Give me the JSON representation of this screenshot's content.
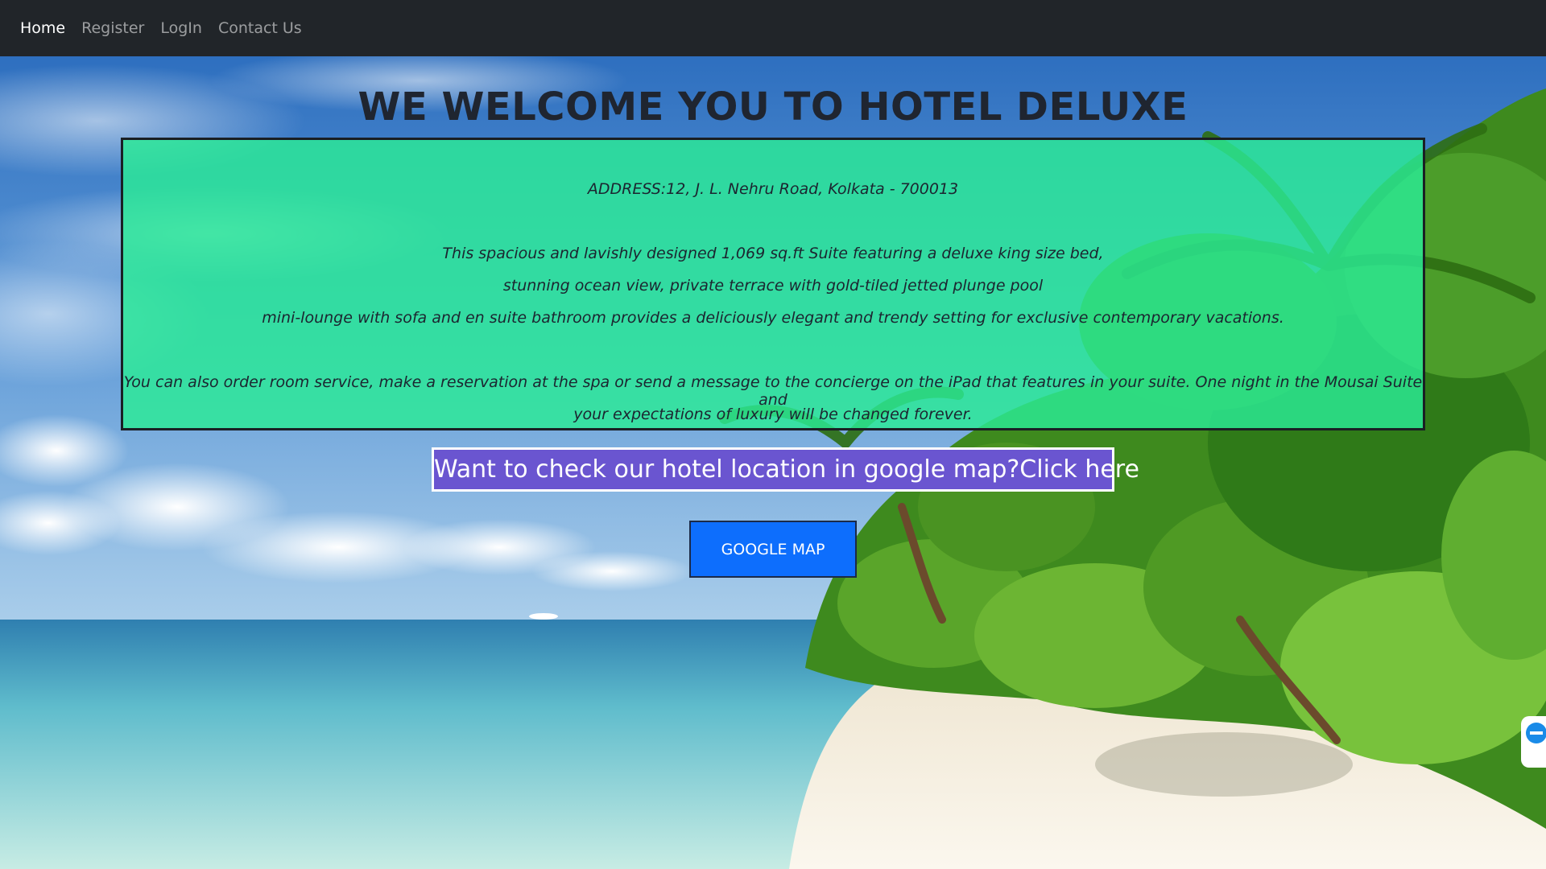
{
  "nav": {
    "items": [
      {
        "label": "Home",
        "active": true
      },
      {
        "label": "Register",
        "active": false
      },
      {
        "label": "LogIn",
        "active": false
      },
      {
        "label": "Contact Us",
        "active": false
      }
    ]
  },
  "hero": {
    "title": "WE WELCOME YOU TO HOTEL DELUXE",
    "address": "ADDRESS:12, J. L. Nehru Road, Kolkata - 700013",
    "description": [
      "This spacious and lavishly designed 1,069 sq.ft Suite featuring a deluxe king size bed,",
      "stunning ocean view, private terrace with gold-tiled jetted plunge pool",
      "mini-lounge with sofa and en suite bathroom provides a deliciously elegant and trendy setting for exclusive contemporary vacations."
    ],
    "room_service": [
      "You can also order room service, make a reservation at the spa or send a message to the concierge on the iPad that features in your suite. One night in the Mousai Suite and",
      "your expectations of luxury will be changed forever."
    ],
    "map_prompt": "Want to check our hotel location in google map?Click here",
    "map_button": "GOOGLE MAP"
  },
  "side_widget": {
    "icon": "remote-support-icon"
  },
  "colors": {
    "navbar": "#212529",
    "info_box": "#2beb96",
    "map_prompt": "#6a55d0",
    "button": "#0d6efd"
  }
}
